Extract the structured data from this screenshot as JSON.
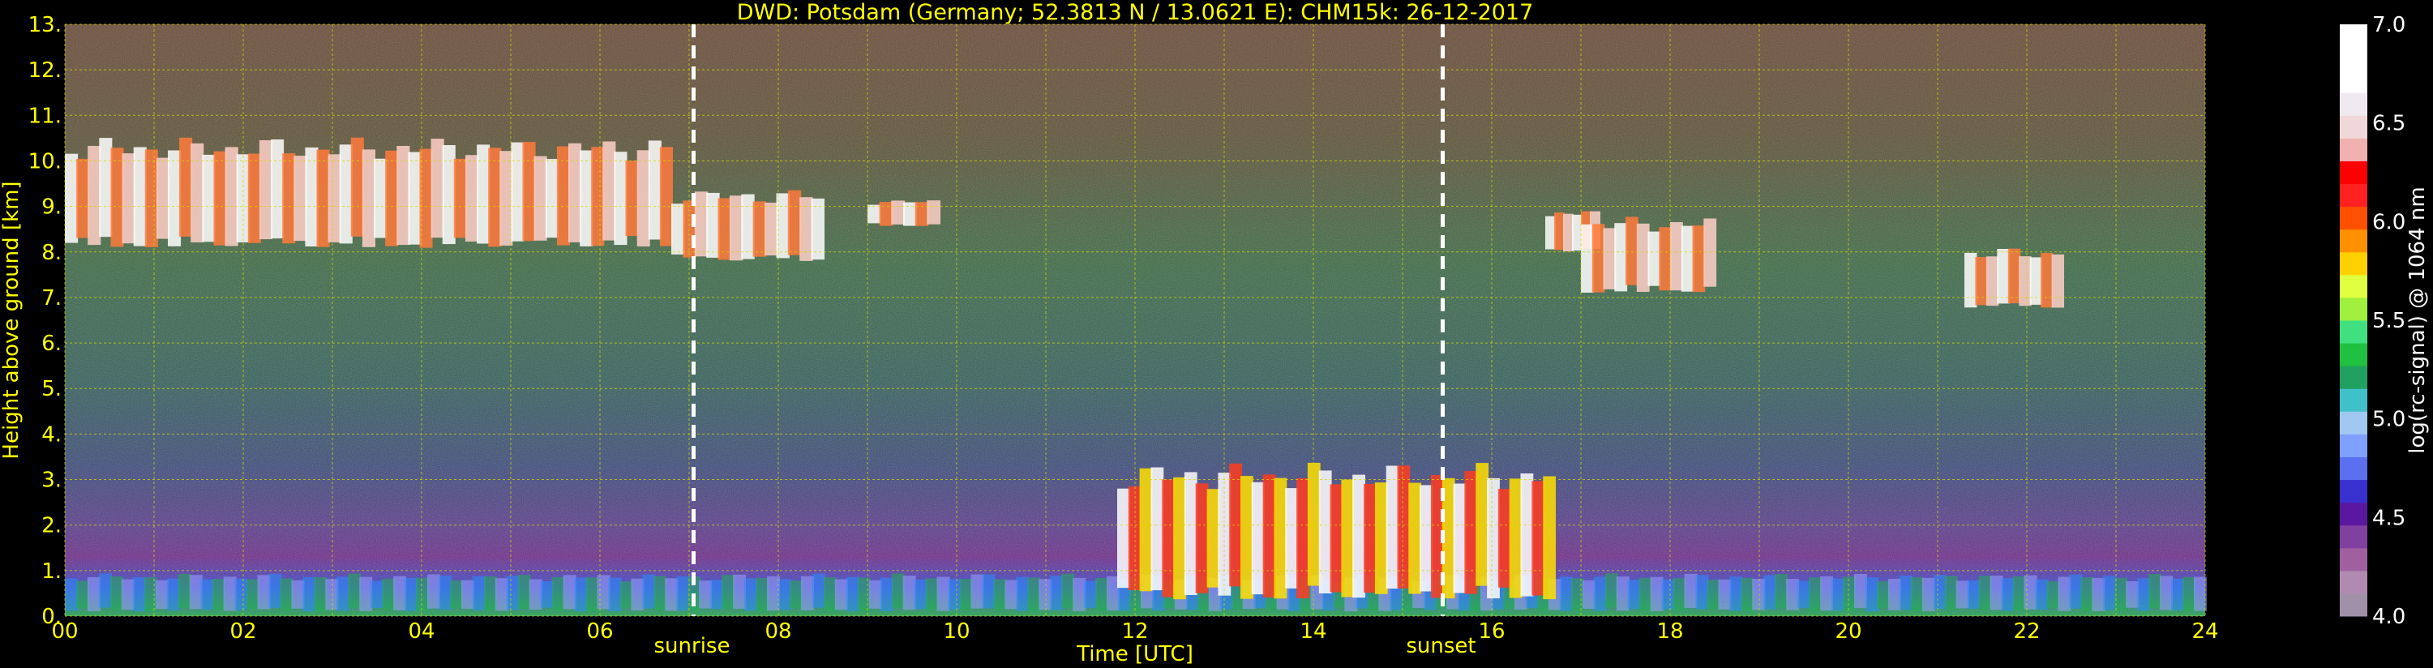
{
  "chart_data": {
    "type": "heatmap",
    "title": "DWD: Potsdam (Germany; 52.3813 N / 13.0621 E):    CHM15k: 26-12-2017",
    "xlabel": "Time [UTC]",
    "ylabel": "Height above ground [km]",
    "xlim": [
      0,
      24
    ],
    "ylim": [
      0,
      13
    ],
    "x_ticks": [
      "00",
      "02",
      "04",
      "06",
      "08",
      "10",
      "12",
      "14",
      "16",
      "18",
      "20",
      "22",
      "24"
    ],
    "y_ticks": [
      "0.",
      "1.",
      "2.",
      "3.",
      "4.",
      "5.",
      "6.",
      "7.",
      "8.",
      "9.",
      "10.",
      "11.",
      "12.",
      "13."
    ],
    "grid": true,
    "markers": [
      {
        "label": "sunrise",
        "time_h": 7.05
      },
      {
        "label": "sunset",
        "time_h": 15.45
      }
    ],
    "colorbar": {
      "label": "log(rc-signal) @ 1064 nm",
      "range": [
        4.0,
        7.0
      ],
      "ticks": [
        "4.0",
        "4.5",
        "5.0",
        "5.5",
        "6.0",
        "6.5",
        "7.0"
      ]
    },
    "features": [
      {
        "kind": "cirrus",
        "t_start": 0.0,
        "t_end": 6.8,
        "h_bottom": 7.8,
        "h_top": 10.7
      },
      {
        "kind": "cirrus",
        "t_start": 6.8,
        "t_end": 8.5,
        "h_bottom": 7.6,
        "h_top": 9.5
      },
      {
        "kind": "cirrus",
        "t_start": 9.0,
        "t_end": 9.8,
        "h_bottom": 8.5,
        "h_top": 9.2
      },
      {
        "kind": "cirrus",
        "t_start": 16.6,
        "t_end": 17.2,
        "h_bottom": 7.9,
        "h_top": 9.0
      },
      {
        "kind": "cirrus",
        "t_start": 17.0,
        "t_end": 18.5,
        "h_bottom": 6.9,
        "h_top": 8.9
      },
      {
        "kind": "cirrus",
        "t_start": 21.3,
        "t_end": 22.4,
        "h_bottom": 6.6,
        "h_top": 8.2
      },
      {
        "kind": "boundary_layer",
        "t_start": 0.0,
        "t_end": 24.0,
        "h_bottom": 0.0,
        "h_top": 1.0
      },
      {
        "kind": "low_cloud",
        "t_start": 11.8,
        "t_end": 16.7,
        "h_bottom": 0.0,
        "h_top": 3.6
      }
    ]
  }
}
